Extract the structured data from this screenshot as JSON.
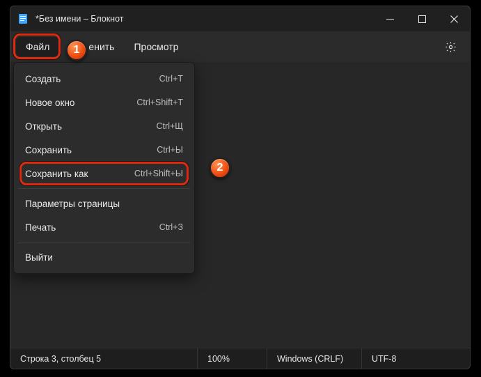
{
  "titlebar": {
    "title": "*Без имени – Блокнот"
  },
  "menubar": {
    "file": "Файл",
    "edit_fragment": "енить",
    "view": "Просмотр"
  },
  "dropdown": {
    "items": [
      {
        "label": "Создать",
        "shortcut": "Ctrl+T"
      },
      {
        "label": "Новое окно",
        "shortcut": "Ctrl+Shift+T"
      },
      {
        "label": "Открыть",
        "shortcut": "Ctrl+Щ"
      },
      {
        "label": "Сохранить",
        "shortcut": "Ctrl+Ы"
      },
      {
        "label": "Сохранить как",
        "shortcut": "Ctrl+Shift+Ы"
      },
      {
        "label": "Параметры страницы",
        "shortcut": ""
      },
      {
        "label": "Печать",
        "shortcut": "Ctrl+З"
      },
      {
        "label": "Выйти",
        "shortcut": ""
      }
    ]
  },
  "callouts": {
    "one": "1",
    "two": "2"
  },
  "statusbar": {
    "position": "Строка 3, столбец 5",
    "zoom": "100%",
    "eol": "Windows (CRLF)",
    "encoding": "UTF-8"
  }
}
